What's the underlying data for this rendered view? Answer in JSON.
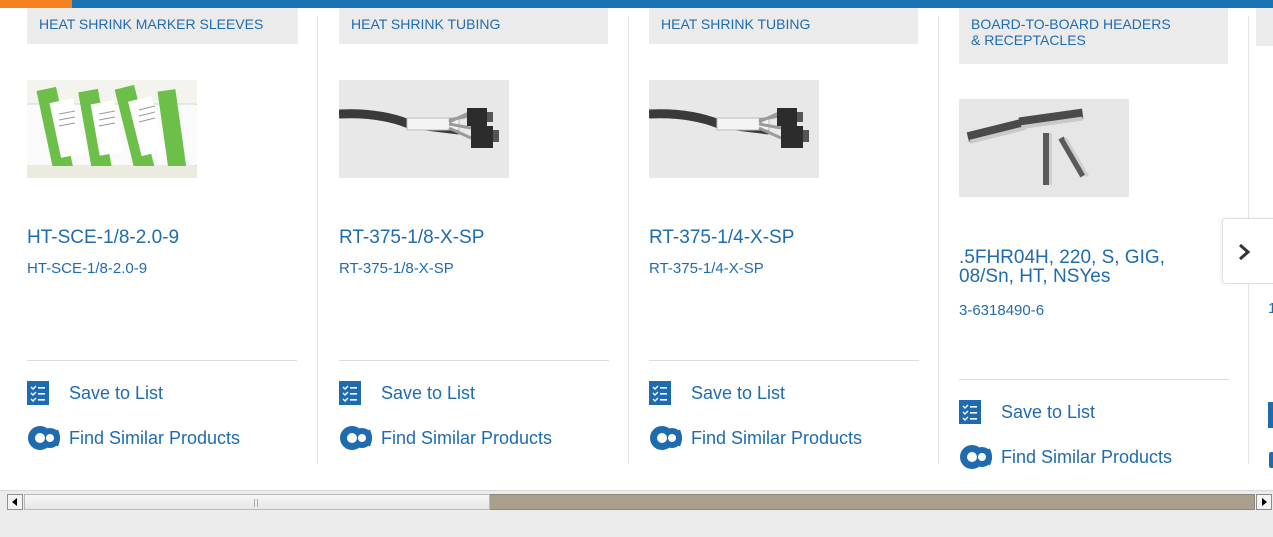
{
  "products": [
    {
      "category": "HEAT SHRINK MARKER SLEEVES",
      "name": "HT-SCE-1/8-2.0-9",
      "part_number": "HT-SCE-1/8-2.0-9",
      "save_label": "Save to List",
      "similar_label": "Find Similar Products"
    },
    {
      "category": "HEAT SHRINK TUBING",
      "name": "RT-375-1/8-X-SP",
      "part_number": "RT-375-1/8-X-SP",
      "save_label": "Save to List",
      "similar_label": "Find Similar Products"
    },
    {
      "category": "HEAT SHRINK TUBING",
      "name": "RT-375-1/4-X-SP",
      "part_number": "RT-375-1/4-X-SP",
      "save_label": "Save to List",
      "similar_label": "Find Similar Products"
    },
    {
      "category_line1": "BOARD-TO-BOARD HEADERS",
      "category_line2": "& RECEPTACLES",
      "name_line1": ".5FHR04H, 220, S, GIG,",
      "name_line2": "08/Sn, HT, NSYes",
      "part_number": "3-6318490-6",
      "save_label": "Save to List",
      "similar_label": "Find Similar Products"
    }
  ],
  "partial_next": {
    "part_number_fragment": "1"
  },
  "icons": {
    "save": "checklist-icon",
    "similar": "gears-icon",
    "next": "chevron-right-icon",
    "scroll_left": "triangle-left-icon",
    "scroll_right": "triangle-right-icon"
  },
  "colors": {
    "brand_blue": "#1f6bb0",
    "top_bar": "#1a73b0",
    "top_accent": "#f58220",
    "category_bg": "#ebebeb",
    "marker_green": "#6cc04a"
  },
  "scrollbar": {
    "position_fraction": 0.0,
    "visible_fraction": 0.38
  }
}
